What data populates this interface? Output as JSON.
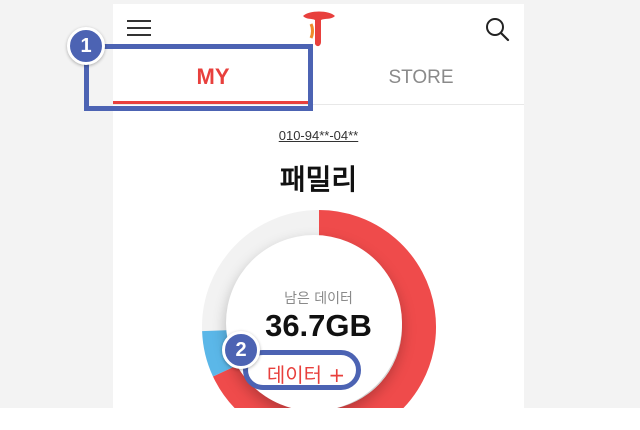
{
  "header": {
    "menu_icon": "hamburger-menu-icon",
    "logo_icon": "t-logo-icon",
    "search_icon": "search-icon"
  },
  "tabs": [
    {
      "label": "MY",
      "active": true
    },
    {
      "label": "STORE",
      "active": false
    }
  ],
  "account": {
    "phone_number": "010-94**-04**",
    "plan_name": "패밀리"
  },
  "data_usage": {
    "remaining_label": "남은 데이터",
    "remaining_value": "36.7GB",
    "add_button_label": "데이터 +"
  },
  "annotations": [
    {
      "number": "1"
    },
    {
      "number": "2"
    }
  ],
  "colors": {
    "accent": "#e8403d",
    "donut_remaining": "#ef4b4b",
    "donut_blue": "#5bb7e8",
    "donut_track": "#f2f2f2",
    "annotation": "#4c63b3"
  }
}
